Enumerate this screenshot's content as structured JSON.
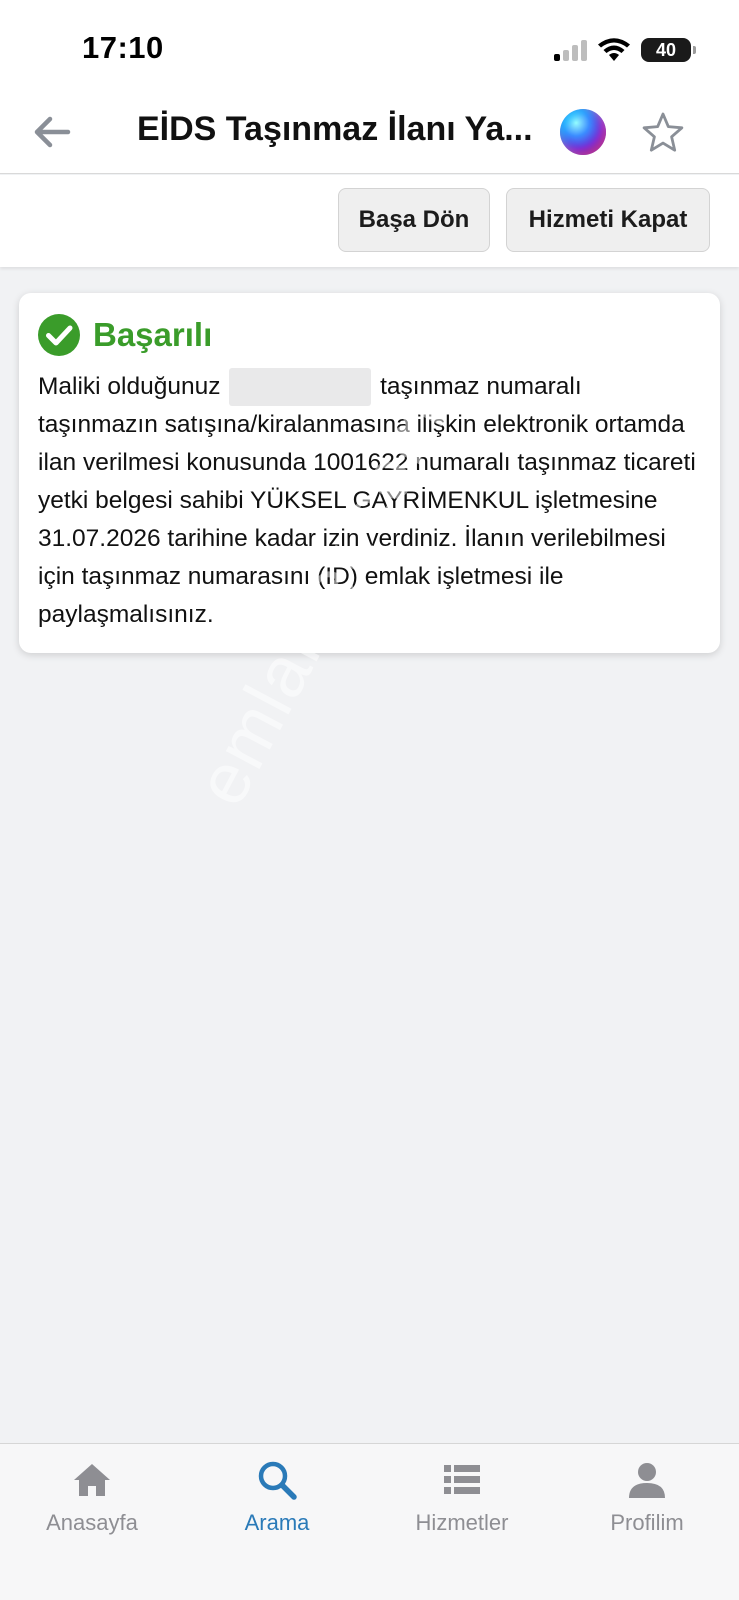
{
  "status_bar": {
    "time": "17:10",
    "battery": "40"
  },
  "header": {
    "title": "EİDS Taşınmaz İlanı Ya..."
  },
  "actions": {
    "restart_label": "Başa Dön",
    "close_label": "Hizmeti Kapat"
  },
  "card": {
    "title": "Başarılı",
    "text_before": "Maliki olduğunuz",
    "text_after": "taşınmaz numaralı taşınmazın satışına/kiralanmasına ilişkin elektronik ortamda ilan verilmesi konusunda 1001622 numaralı taşınmaz ticareti yetki belgesi sahibi YÜKSEL GAYRİMENKUL işletmesine 31.07.2026 tarihine kadar izin verdiniz. İlanın verilebilmesi için taşınmaz numarasını (ID) emlak işletmesi ile paylaşmalısınız."
  },
  "watermark": "emlakjet.com",
  "tabs": [
    {
      "label": "Anasayfa",
      "icon": "home-icon",
      "active": false
    },
    {
      "label": "Arama",
      "icon": "search-icon",
      "active": true
    },
    {
      "label": "Hizmetler",
      "icon": "list-icon",
      "active": false
    },
    {
      "label": "Profilim",
      "icon": "person-icon",
      "active": false
    }
  ],
  "colors": {
    "success": "#3a9c2a",
    "active_tab": "#2a7ab8",
    "inactive_tab": "#8e8e93",
    "background": "#f1f2f4"
  }
}
